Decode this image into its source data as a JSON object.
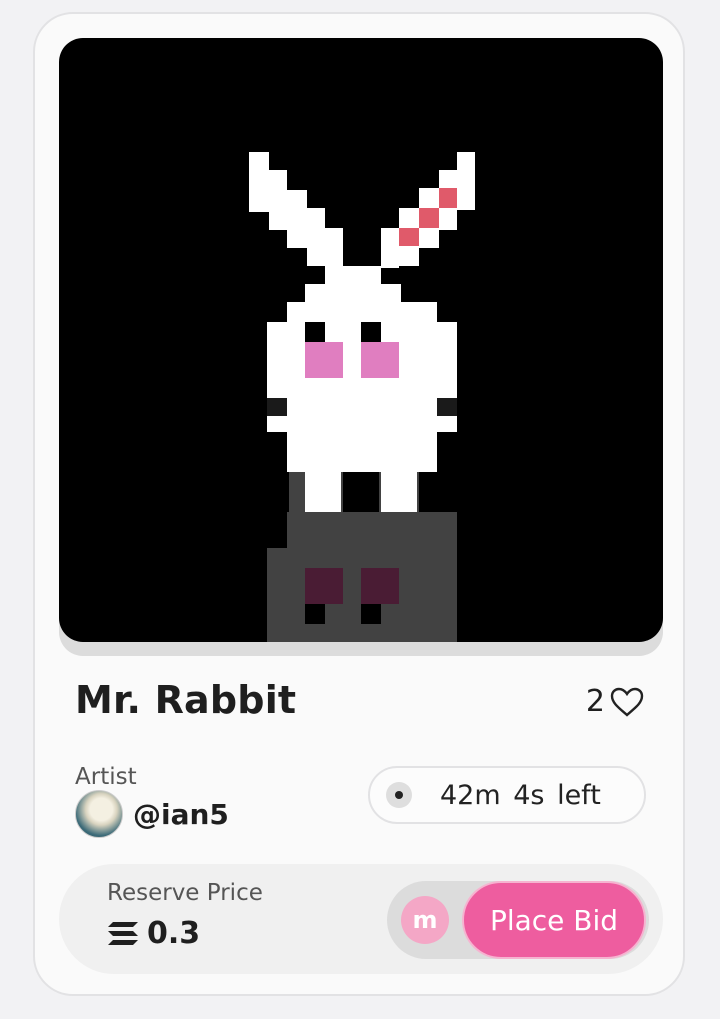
{
  "artwork": {
    "title": "Mr. Rabbit",
    "likes": "2",
    "artist_label": "Artist",
    "artist_handle": "@ian5",
    "time_left": "42m 4s  left"
  },
  "bid": {
    "reserve_label": "Reserve Price",
    "reserve_value": "0.3",
    "currency_icon": "solana-icon",
    "marketplace_icon_letter": "m",
    "button_label": "Place Bid"
  },
  "colors": {
    "accent": "#ee5d9f",
    "accent_light": "#f4a7c6",
    "card_bg": "#fafafa",
    "page_bg": "#f2f2f4"
  }
}
